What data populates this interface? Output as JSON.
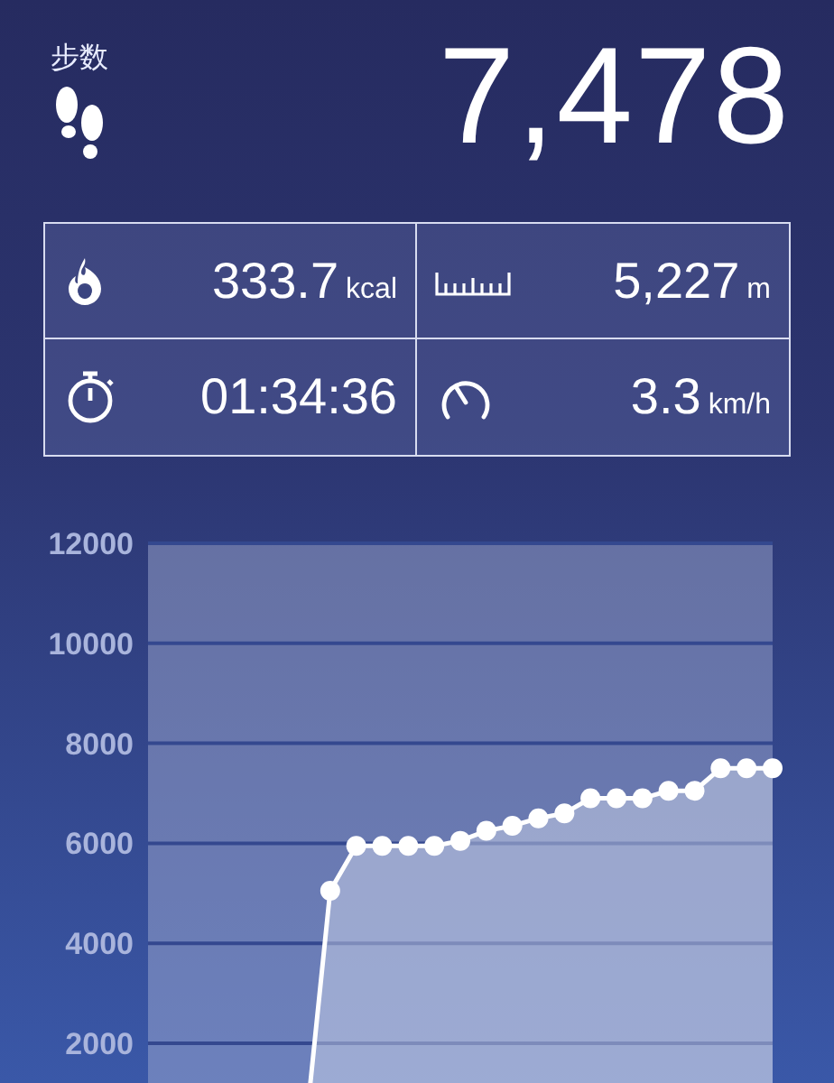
{
  "header": {
    "label": "步数",
    "steps": "7,478"
  },
  "stats": [
    {
      "kind": "calories",
      "value": "333.7",
      "unit": "kcal"
    },
    {
      "kind": "distance",
      "value": "5,227",
      "unit": "m"
    },
    {
      "kind": "duration",
      "value": "01:34:36"
    },
    {
      "kind": "speed",
      "value": "3.3",
      "unit": "km/h"
    }
  ],
  "chart": {
    "chart_data": {
      "type": "area",
      "grid": true,
      "ylim": [
        0,
        12000
      ],
      "yticks": [
        2000,
        4000,
        6000,
        8000,
        10000,
        12000
      ],
      "series": [
        {
          "color": "#ffffff",
          "values": [
            null,
            null,
            null,
            null,
            null,
            null,
            0,
            5050,
            5950,
            5950,
            5950,
            5950,
            6050,
            6250,
            6350,
            6500,
            6600,
            6900,
            6900,
            6900,
            7050,
            7050,
            7500,
            7500,
            7500
          ]
        }
      ]
    }
  }
}
